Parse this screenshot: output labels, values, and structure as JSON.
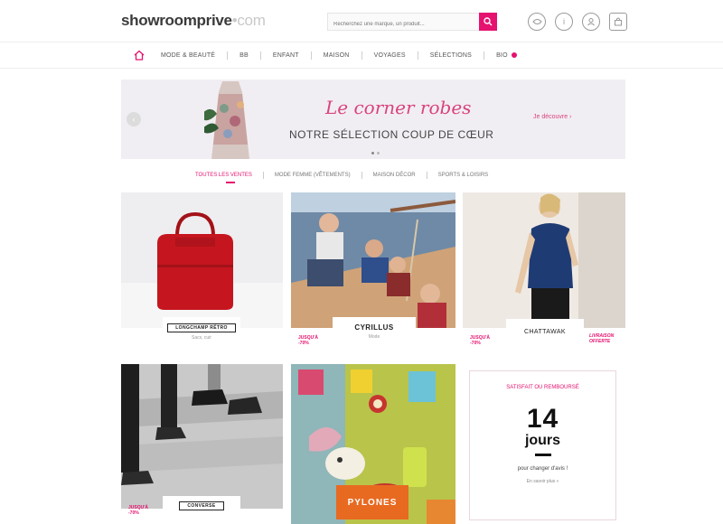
{
  "header": {
    "logo_main": "showroomprive",
    "logo_suffix": "•com",
    "search_placeholder": "Recherchez une marque, un produit...",
    "icons": [
      "account-icon",
      "help-icon",
      "user-icon",
      "bag-icon"
    ]
  },
  "nav": {
    "items": [
      {
        "label": "Mode & Beauté"
      },
      {
        "label": "BB"
      },
      {
        "label": "Enfant"
      },
      {
        "label": "Maison"
      },
      {
        "label": "Voyages"
      },
      {
        "label": "Sélections"
      },
      {
        "label": "Bio"
      }
    ]
  },
  "banner": {
    "script_title": "Le corner robes",
    "subtitle": "Notre sélection coup de cœur",
    "link": "Je découvre ›"
  },
  "filters": {
    "tabs": [
      {
        "label": "Toutes les ventes"
      },
      {
        "label": "Mode femme (vêtements)"
      },
      {
        "label": "Maison décor"
      },
      {
        "label": "Sports & loisirs"
      }
    ]
  },
  "cards": [
    {
      "brand": "Longchamp Rétro",
      "sub": "Sacs, cuir"
    },
    {
      "brand": "Cyrillus",
      "sub": "Mode",
      "badge": "Jusqu'à -70%"
    },
    {
      "brand": "Chattawak",
      "sub": "",
      "badge": "Jusqu'à -70%",
      "badge2": "Livraison offerte"
    },
    {
      "brand": "Converse",
      "sub": "",
      "badge": "Jusqu'à -70%"
    },
    {
      "brand": "Pylones",
      "sub": ""
    }
  ],
  "promo": {
    "top": "Satisfait ou remboursé",
    "number": "14",
    "unit": "jours",
    "text": "pour changer d'avis !",
    "link": "En savoir plus »"
  },
  "colors": {
    "accent": "#e5126f",
    "banner_bg": "#f1eef3"
  }
}
